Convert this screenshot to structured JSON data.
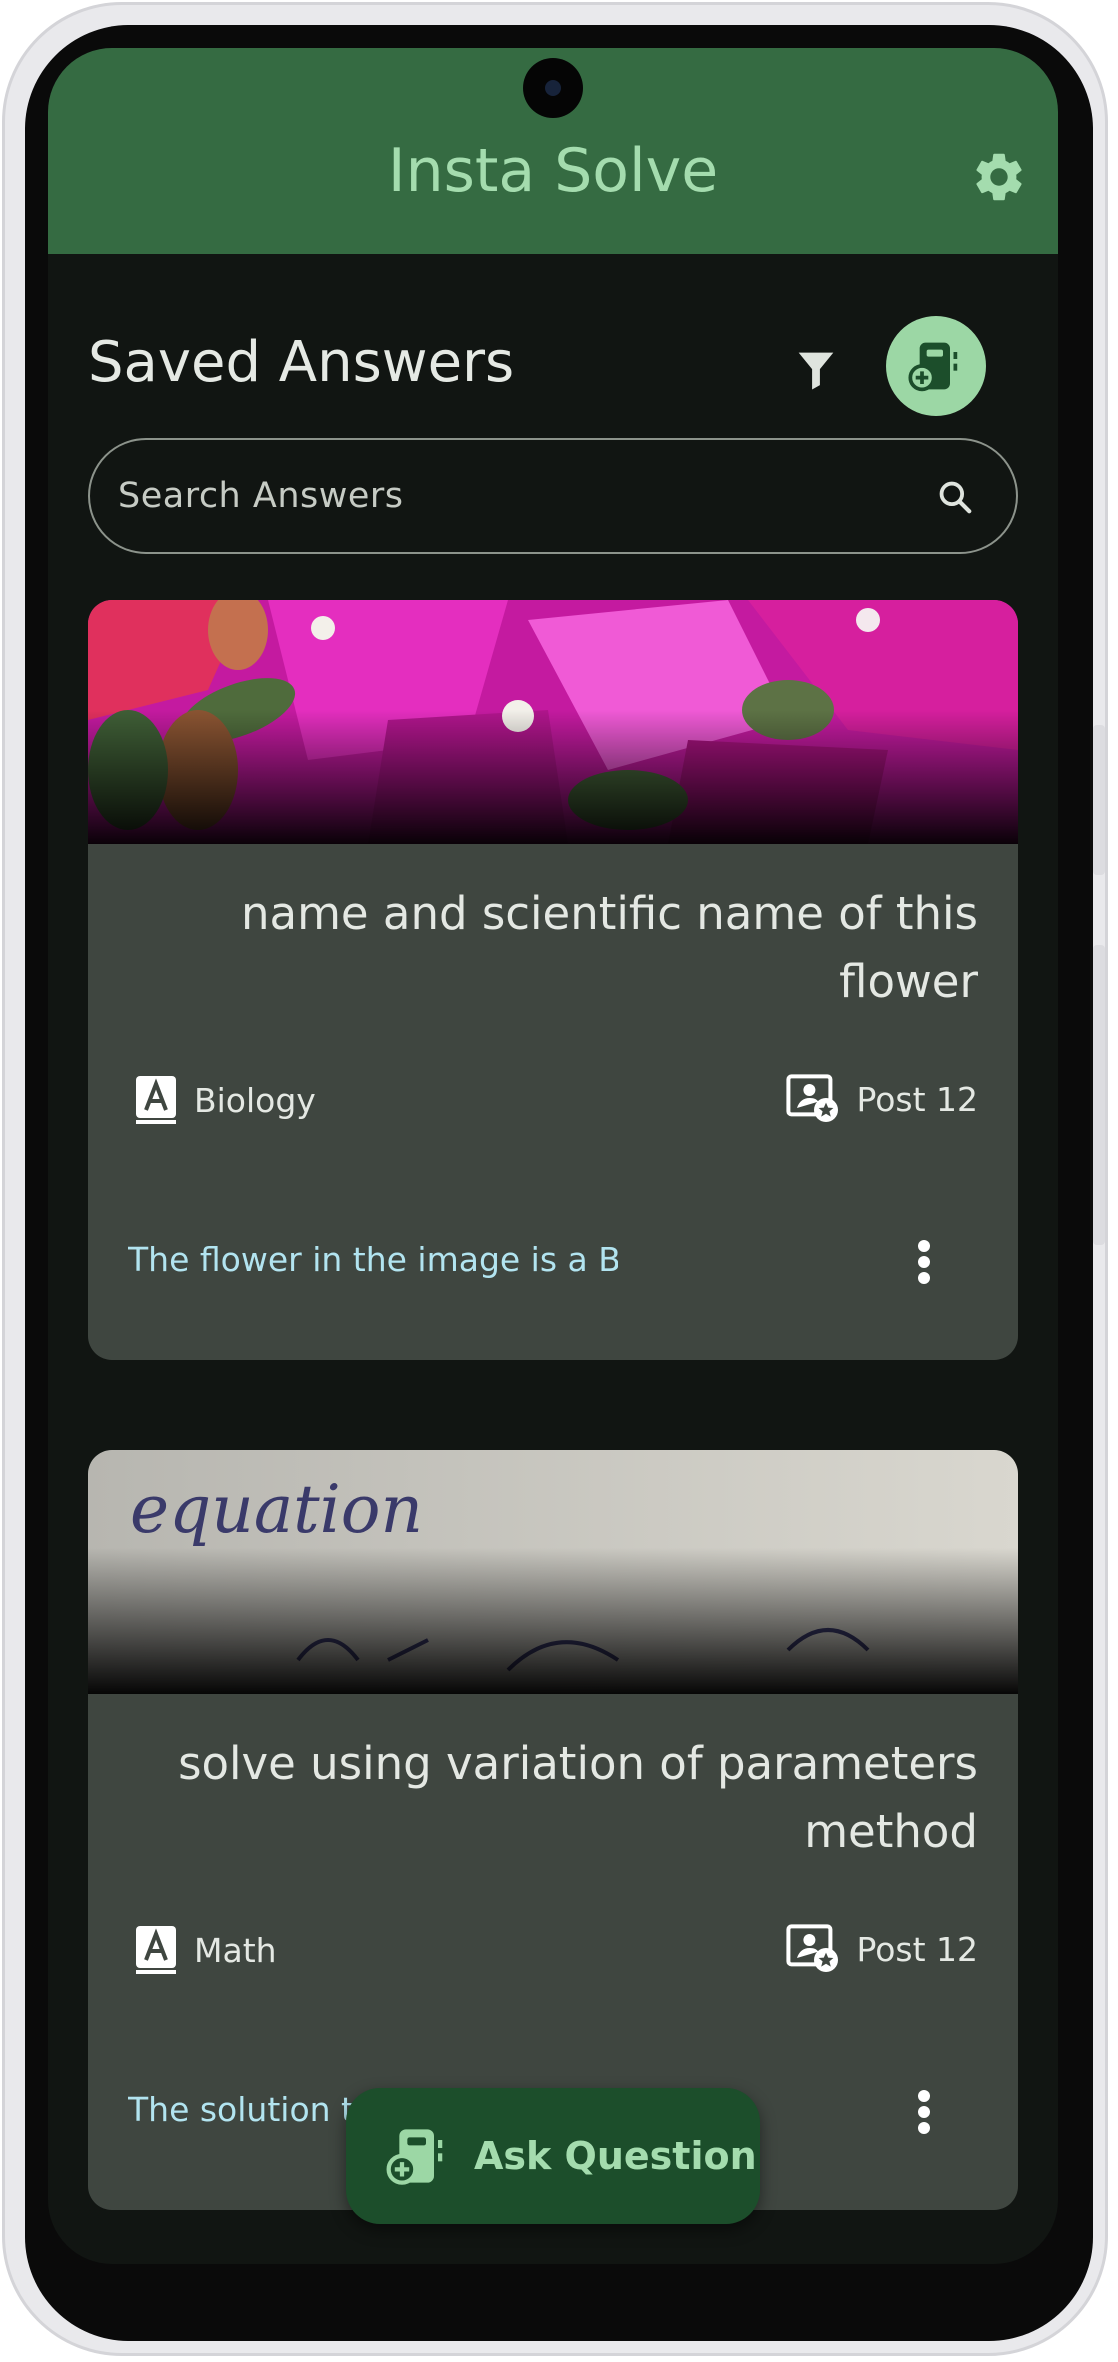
{
  "app_bar": {
    "title": "Insta Solve",
    "settings_icon": "gear-icon",
    "background": "#356b42",
    "title_color": "#a4dcae"
  },
  "header": {
    "title": "Saved Answers",
    "filter_icon": "filter-icon",
    "new_question_icon": "add-question-icon"
  },
  "search": {
    "placeholder": "Search Answers",
    "value": "",
    "icon": "search-icon"
  },
  "cards": [
    {
      "image": "pink bougainvillea flowers photo",
      "title": "name and scientific name of this flower",
      "subject": "Biology",
      "subject_icon": "subject-book-icon",
      "post": "Post 12",
      "post_icon": "post-badge-icon",
      "preview": "The flower in the image is a Bo",
      "menu_icon": "more-vert-icon"
    },
    {
      "image": "handwritten equation photo",
      "image_text": "equation",
      "title": "solve using variation of parameters method",
      "subject": "Math",
      "subject_icon": "subject-book-icon",
      "post": "Post 12",
      "post_icon": "post-badge-icon",
      "preview": "The solution to",
      "menu_icon": "more-vert-icon"
    }
  ],
  "fab": {
    "label": "Ask Question",
    "icon": "add-question-icon",
    "background": "#1c4e2b"
  },
  "colors": {
    "screen_bg": "#111512",
    "card_bg": "#3f4640",
    "accent": "#9cd7a5",
    "preview_text": "#b2e4f0"
  }
}
